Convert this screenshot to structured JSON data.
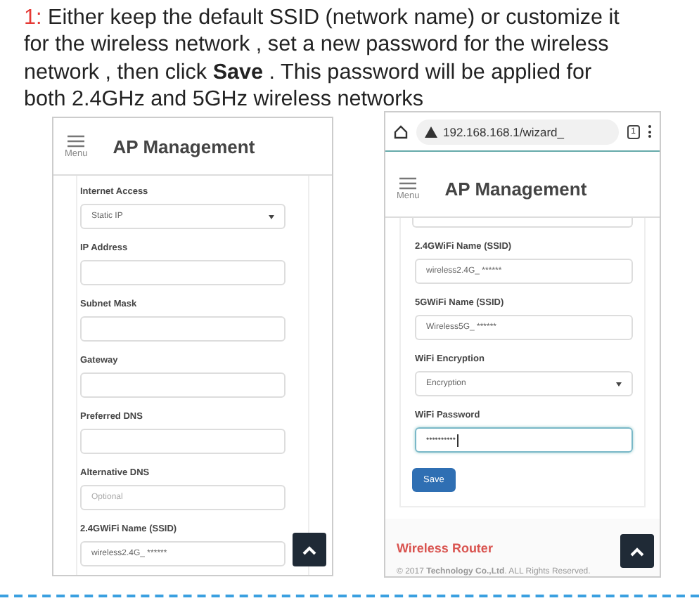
{
  "instruction": {
    "number": "1:",
    "text": "Either keep the default SSID (network name) or customize it\nfor the wireless network , set a new password  for the wireless\nnetwork , then click  **Save** .  This password will be applied for\nboth 2.4GHz and 5GHz wireless networks"
  },
  "left_phone": {
    "header": {
      "menu_label": "Menu",
      "title": "AP Management"
    },
    "fields": [
      {
        "kind": "select",
        "label": "Internet Access",
        "value": "Static IP",
        "focused": false
      },
      {
        "kind": "input",
        "label": "IP Address",
        "focused": false
      },
      {
        "kind": "input",
        "label": "Subnet Mask",
        "focused": false
      },
      {
        "kind": "input",
        "label": "Gateway",
        "focused": false
      },
      {
        "kind": "input",
        "label": "Preferred DNS",
        "focused": false
      },
      {
        "kind": "input",
        "label": "Alternative DNS",
        "placeholder": "Optional",
        "focused": false
      },
      {
        "kind": "input",
        "label": "2.4GWiFi Name (SSID)",
        "value": "wireless2.4G_ ******",
        "focused": false
      }
    ]
  },
  "right_phone": {
    "browser_bar": {
      "url": "192.168.168.1/wizard_",
      "tab_count": "1"
    },
    "header": {
      "menu_label": "Menu",
      "title": "AP Management"
    },
    "fields": [
      {
        "kind": "input",
        "label": "2.4GWiFi Name (SSID)",
        "value": "wireless2.4G_ ******",
        "focused": false
      },
      {
        "kind": "input",
        "label": "5GWiFi Name (SSID)",
        "value": "Wireless5G_ ******",
        "focused": false
      },
      {
        "kind": "select",
        "label": "WiFi Encryption",
        "value": "Encryption",
        "focused": false
      },
      {
        "kind": "password",
        "label": "WiFi Password",
        "value": "••••••••••",
        "focused": true
      }
    ],
    "save_button": "Save",
    "footer": {
      "brand": "Wireless Router",
      "copyright": "© 2017 **Technology Co.,Ltd**. ALL Rights Reserved."
    }
  }
}
